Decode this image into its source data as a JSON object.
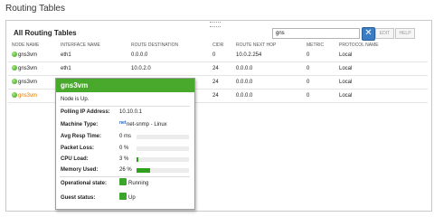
{
  "page": {
    "title": "Routing Tables"
  },
  "panel": {
    "title": "All Routing Tables"
  },
  "search": {
    "value": "gns",
    "clear_label": "✕"
  },
  "buttons": {
    "edit": "EDIT",
    "help": "HELP"
  },
  "table": {
    "headers": [
      "NODE NAME",
      "INTERFACE NAME",
      "ROUTE DESTINATION",
      "CIDR",
      "ROUTE NEXT HOP",
      "METRIC",
      "PROTOCOL NAME"
    ],
    "rows": [
      {
        "node": "gns3vm",
        "interface": "eth1",
        "destination": "0.0.0.0",
        "cidr": "0",
        "next_hop": "10.0.2.254",
        "metric": "0",
        "protocol": "Local"
      },
      {
        "node": "gns3vm",
        "interface": "eth1",
        "destination": "10.0.2.0",
        "cidr": "24",
        "next_hop": "0.0.0.0",
        "metric": "0",
        "protocol": "Local"
      },
      {
        "node": "gns3vm",
        "interface": "",
        "destination": "",
        "cidr": "24",
        "next_hop": "0.0.0.0",
        "metric": "0",
        "protocol": "Local"
      },
      {
        "node": "gns3vm",
        "interface": "",
        "destination": "",
        "cidr": "24",
        "next_hop": "0.0.0.0",
        "metric": "0",
        "protocol": "Local"
      }
    ]
  },
  "tooltip": {
    "title": "gns3vm",
    "status": "Node is Up.",
    "polling_ip_label": "Polling IP Address:",
    "polling_ip": "10.10.0.1",
    "machine_type_label": "Machine Type:",
    "machine_type": "net-snmp - Linux",
    "machine_icon_text": "net",
    "avg_resp_label": "Avg Resp Time:",
    "avg_resp": "0 ms",
    "avg_resp_level": 0,
    "packet_loss_label": "Packet Loss:",
    "packet_loss": "0 %",
    "packet_loss_level": 0,
    "cpu_label": "CPU Load:",
    "cpu": "3 %",
    "cpu_level": 0.03,
    "memory_label": "Memory Used:",
    "memory": "26 %",
    "memory_level": 0.26,
    "operational_label": "Operational state:",
    "operational_value": "Running",
    "guest_label": "Guest status:",
    "guest_value": "Up"
  },
  "colors": {
    "status_green": "#49a92c",
    "hover_orange": "#e07b00",
    "bar_green": "#2fa11c"
  }
}
